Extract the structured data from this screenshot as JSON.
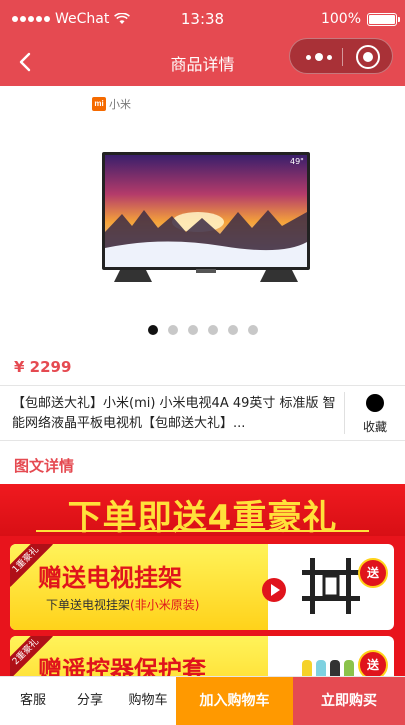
{
  "status_bar": {
    "carrier": "WeChat",
    "time": "13:38",
    "battery": "100%"
  },
  "nav": {
    "title": "商品详情"
  },
  "product": {
    "brand_label": "小米",
    "screen_size_badge": "49\"",
    "carousel": {
      "total": 6,
      "active": 1
    },
    "price": "¥ 2299",
    "name": "【包邮送大礼】小米(mi) 小米电视4A 49英寸 标准版 智能网络液晶平板电视机【包邮送大礼】...",
    "favorite_label": "收藏"
  },
  "detail_section": {
    "title": "图文详情"
  },
  "promo": {
    "headline": "下单即送4重豪礼",
    "gifts": [
      {
        "ribbon": "1重豪礼",
        "title": "赠送电视挂架",
        "subtitle_main": "下单送电视挂架",
        "subtitle_note": "(非小米原装)",
        "badge": "送"
      },
      {
        "ribbon": "2重豪礼",
        "title": "赠遥控器保护套",
        "subtitle_main": "",
        "subtitle_note": "",
        "badge": "送"
      }
    ]
  },
  "bottom_bar": {
    "service": "客服",
    "share": "分享",
    "cart": "购物车",
    "add_to_cart": "加入购物车",
    "buy_now": "立即购买"
  },
  "colors": {
    "brand_red": "#e54a51",
    "add_cart_orange": "#ff9900",
    "promo_red": "#e8141c",
    "promo_yellow": "#ffe13a"
  }
}
